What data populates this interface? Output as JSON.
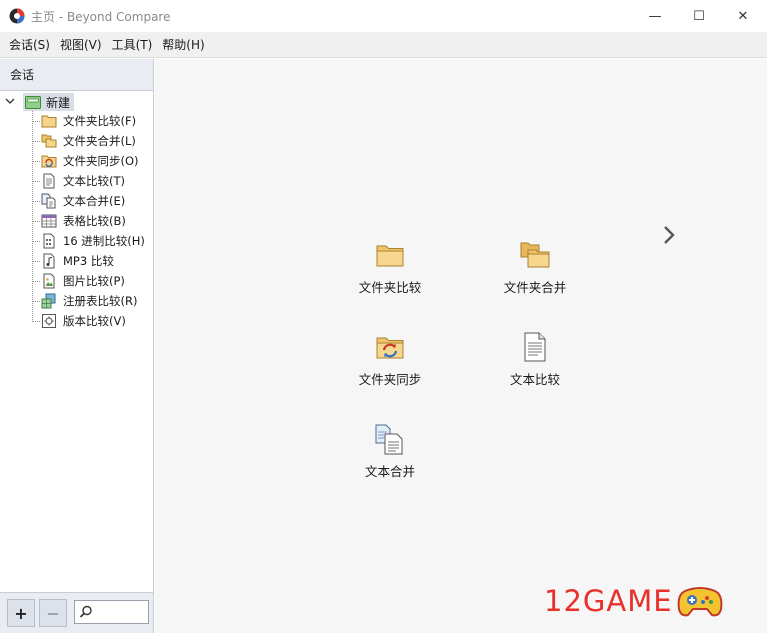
{
  "window": {
    "title": "主页 - Beyond Compare",
    "minimize_glyph": "—",
    "maximize_glyph": "☐",
    "close_glyph": "✕"
  },
  "menu": [
    "会话(S)",
    "视图(V)",
    "工具(T)",
    "帮助(H)"
  ],
  "sidebar": {
    "header": "会话",
    "root": {
      "label": "新建",
      "icon": "new-session-icon"
    },
    "items": [
      {
        "label": "文件夹比较(F)",
        "icon": "folder-compare-icon"
      },
      {
        "label": "文件夹合并(L)",
        "icon": "folder-merge-icon"
      },
      {
        "label": "文件夹同步(O)",
        "icon": "folder-sync-icon"
      },
      {
        "label": "文本比较(T)",
        "icon": "text-compare-icon"
      },
      {
        "label": "文本合并(E)",
        "icon": "text-merge-icon"
      },
      {
        "label": "表格比较(B)",
        "icon": "table-compare-icon"
      },
      {
        "label": "16 进制比较(H)",
        "icon": "hex-compare-icon"
      },
      {
        "label": "MP3 比较",
        "icon": "mp3-compare-icon"
      },
      {
        "label": "图片比较(P)",
        "icon": "picture-compare-icon"
      },
      {
        "label": "注册表比较(R)",
        "icon": "registry-compare-icon"
      },
      {
        "label": "版本比较(V)",
        "icon": "version-compare-icon"
      }
    ],
    "footer": {
      "add_label": "+",
      "remove_label": "−",
      "search_placeholder": ""
    }
  },
  "main": {
    "launchers": [
      {
        "label": "文件夹比较",
        "icon": "folder-compare-icon"
      },
      {
        "label": "文件夹合并",
        "icon": "folder-merge-icon"
      },
      {
        "label": "文件夹同步",
        "icon": "folder-sync-icon"
      },
      {
        "label": "文本比较",
        "icon": "text-compare-icon"
      },
      {
        "label": "文本合并",
        "icon": "text-merge-icon"
      }
    ],
    "next_icon": "chevron-right-icon"
  },
  "watermark": {
    "text": "12GAME",
    "icon": "gamepad-icon"
  },
  "colors": {
    "accent_red": "#e8312a",
    "folder": "#f1c46a",
    "selection": "#d8dde6"
  }
}
